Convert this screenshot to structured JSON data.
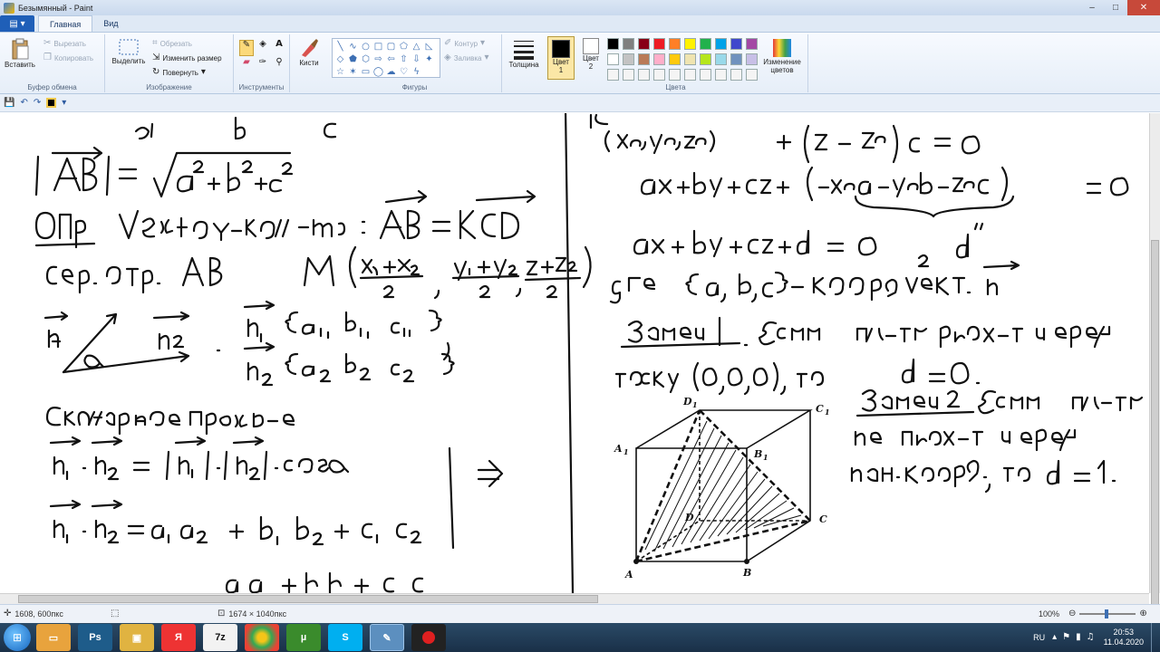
{
  "window": {
    "title": "Безымянный - Paint"
  },
  "tabs": [
    {
      "label": "Главная"
    },
    {
      "label": "Вид"
    }
  ],
  "ribbon": {
    "clipboard": {
      "label": "Буфер обмена",
      "paste": "Вставить",
      "cut": "Вырезать",
      "copy": "Копировать"
    },
    "image": {
      "label": "Изображение",
      "select": "Выделить",
      "crop": "Обрезать",
      "resize": "Изменить размер",
      "rotate": "Повернуть"
    },
    "tools": {
      "label": "Инструменты"
    },
    "brushes": {
      "label": "Кисти"
    },
    "shapes": {
      "label": "Фигуры",
      "outline": "Контур",
      "fill": "Заливка"
    },
    "size": {
      "label": "Толщина"
    },
    "colors": {
      "label": "Цвета",
      "color1_line1": "Цвет",
      "color1_line2": "1",
      "color2_line1": "Цвет",
      "color2_line2": "2",
      "edit_line1": "Изменение",
      "edit_line2": "цветов"
    }
  },
  "palette_row1": [
    "#000000",
    "#7f7f7f",
    "#880015",
    "#ed1c24",
    "#ff7f27",
    "#fff200",
    "#22b14c",
    "#00a2e8",
    "#3f48cc",
    "#a349a4"
  ],
  "palette_row2": [
    "#ffffff",
    "#c3c3c3",
    "#b97a57",
    "#ffaec9",
    "#ffc90e",
    "#efe4b0",
    "#b5e61d",
    "#99d9ea",
    "#7092be",
    "#c8bfe7"
  ],
  "statusbar": {
    "cursor_pos": "1608, 600пкс",
    "image_size": "1674 × 1040пкс",
    "zoom": "100%"
  },
  "taskbar": {
    "lang": "RU",
    "time": "20:53",
    "date": "11.04.2020"
  },
  "colors": {
    "accent": "#1f5fb8",
    "ink": "#111111"
  }
}
